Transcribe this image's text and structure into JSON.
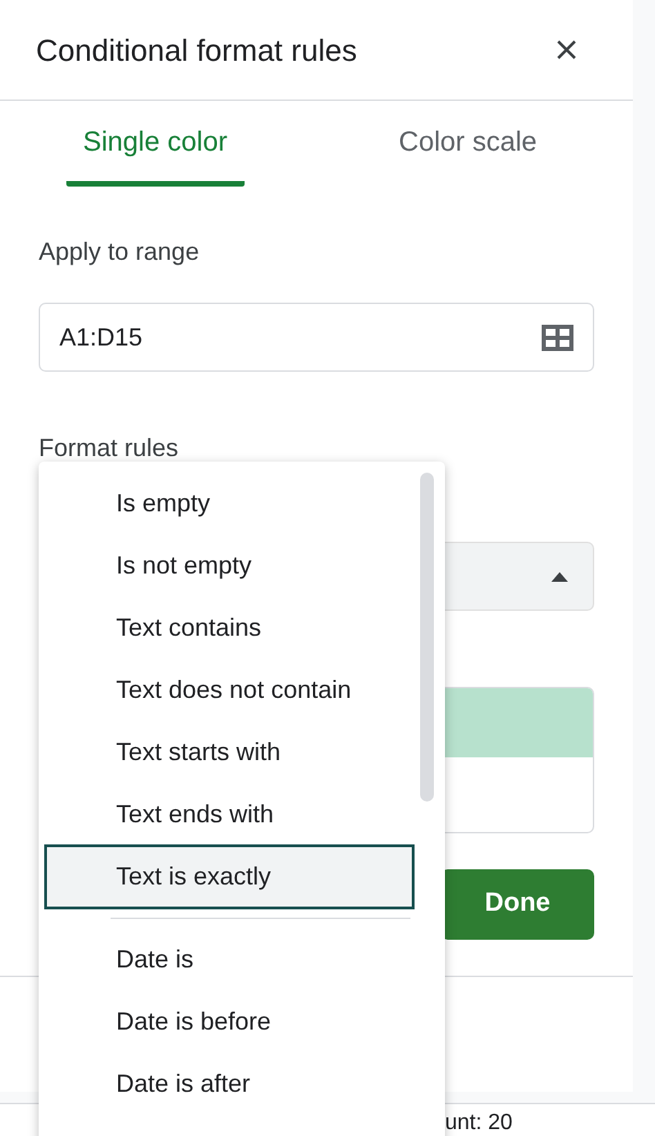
{
  "panel": {
    "title": "Conditional format rules"
  },
  "tabs": [
    {
      "label": "Single color",
      "selected": true
    },
    {
      "label": "Color scale",
      "selected": false
    }
  ],
  "apply_to_range": {
    "label": "Apply to range",
    "value": "A1:D15"
  },
  "format_rules": {
    "label": "Format rules",
    "condition_menu": {
      "expanded": true
    }
  },
  "dropdown": [
    {
      "kind": "option",
      "label": "Is empty",
      "selected": false
    },
    {
      "kind": "option",
      "label": "Is not empty",
      "selected": false
    },
    {
      "kind": "option",
      "label": "Text contains",
      "selected": false
    },
    {
      "kind": "option",
      "label": "Text does not contain",
      "selected": false
    },
    {
      "kind": "option",
      "label": "Text starts with",
      "selected": false
    },
    {
      "kind": "option",
      "label": "Text ends with",
      "selected": false
    },
    {
      "kind": "option",
      "label": "Text is exactly",
      "selected": true
    },
    {
      "kind": "divider"
    },
    {
      "kind": "option",
      "label": "Date is",
      "selected": false
    },
    {
      "kind": "option",
      "label": "Date is before",
      "selected": false
    },
    {
      "kind": "option",
      "label": "Date is after",
      "selected": false
    }
  ],
  "done_button": "Done",
  "status_bar": {
    "text": "unt: 20"
  }
}
